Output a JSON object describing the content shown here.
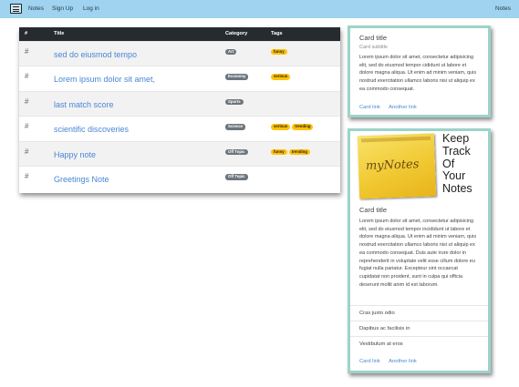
{
  "navbar": {
    "brand_icon": "notes-list-icon",
    "links": [
      "Notes",
      "Sign Up",
      "Log in"
    ],
    "right_link": "Notes"
  },
  "table": {
    "headers": [
      "#",
      "Title",
      "Category",
      "Tags"
    ],
    "rows": [
      {
        "num": "#",
        "title": "sed do eiusmod tempo",
        "category": "Art",
        "tags": [
          "funny"
        ]
      },
      {
        "num": "#",
        "title": "Lorem ipsum dolor sit amet,",
        "category": "Economy",
        "tags": [
          "serious"
        ]
      },
      {
        "num": "#",
        "title": "last match score",
        "category": "Sports",
        "tags": []
      },
      {
        "num": "#",
        "title": "scientific discoveries",
        "category": "Science",
        "tags": [
          "serious",
          "trending"
        ]
      },
      {
        "num": "#",
        "title": "Happy note",
        "category": "Off Topic",
        "tags": [
          "funny",
          "trending"
        ]
      },
      {
        "num": "#",
        "title": "Greetings Note",
        "category": "Off Topic",
        "tags": []
      }
    ]
  },
  "card1": {
    "title": "Card title",
    "subtitle": "Card subtitle",
    "text": "Lorem ipsum dolor sit amet, consectetur adipisicing elit, sed do eiusmod tempor cididunt ut labore et dolore magna aliqua. Ut enim ad minim veniam, quis nostrud exercitation ullamco laboris nisi ut aliquip ex ea commodo consequat.",
    "links": [
      "Card link",
      "Another link"
    ]
  },
  "card2": {
    "image_logo": "myNotes",
    "image_caption": [
      "Keep",
      "Track",
      "Of",
      "Your",
      "Notes"
    ],
    "title": "Card title",
    "text": "Lorem ipsum dolor sit amet, consectetur adipisicing elit, sed do eiusmod tempor incididunt ut labore et dolore magna aliqua. Ut enim ad minim veniam, quis nostrud exercitation ullamco laboris nisi ut aliquip ex ea commodo consequat. Duis aute irure dolor in reprehenderit in voluptate velit esse cillum dolore eu fugiat nulla pariatur. Excepteur sint occaecat cupidatat non proident, sunt in culpa qui officia deserunt mollit anim id est laborum.",
    "list": [
      "Cras justo odio",
      "Dapibus ac facilisis in",
      "Vestibulum at eros"
    ],
    "links": [
      "Card link",
      "Another link"
    ]
  },
  "colors": {
    "navbar": "#9fd3ef",
    "table_header": "#262b30",
    "link": "#4a86d6",
    "card_border": "#9dd3c9",
    "tag_badge": "#ffc107",
    "category_badge": "#6d757d"
  }
}
